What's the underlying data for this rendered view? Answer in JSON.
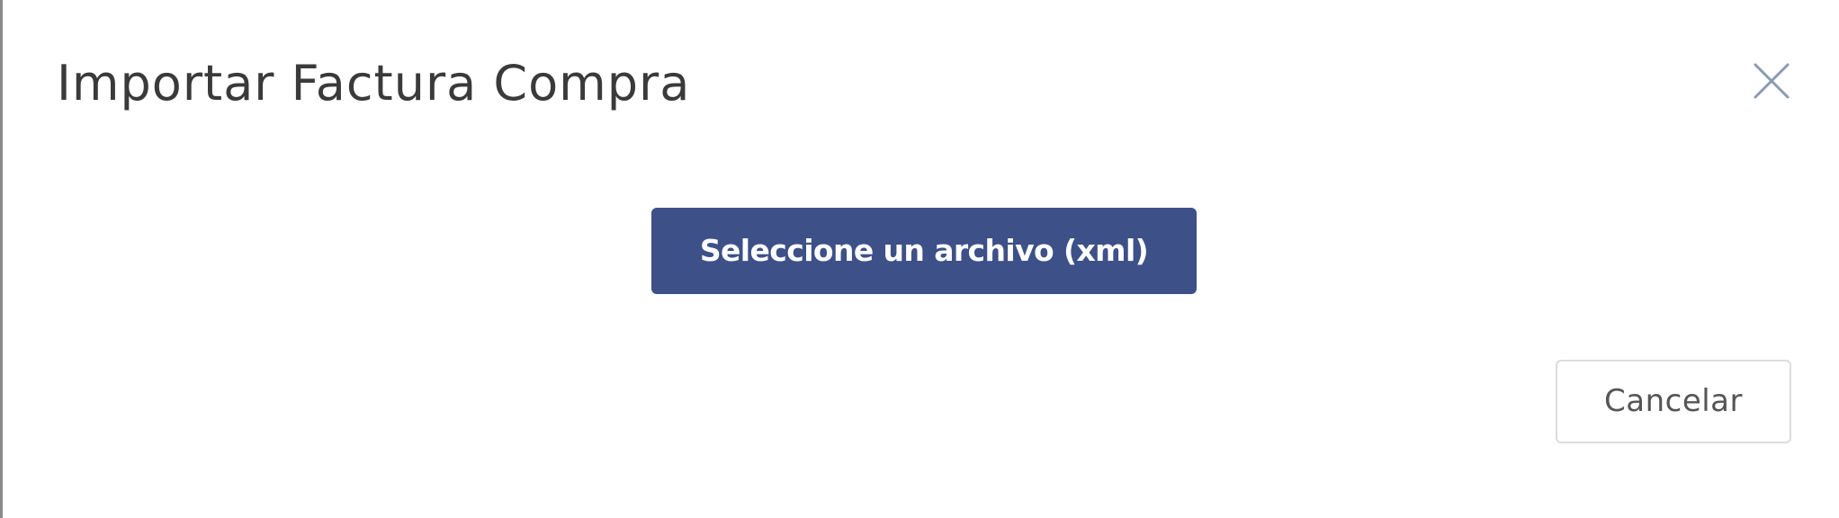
{
  "modal": {
    "title": "Importar Factura Compra",
    "close_icon": "close-icon",
    "file_button_label": "Seleccione un archivo (xml)",
    "cancel_label": "Cancelar"
  },
  "colors": {
    "primary": "#3d5088",
    "title_text": "#3a3a3a",
    "close_icon": "#8a9bb0",
    "cancel_border": "#dcdcdc",
    "cancel_text": "#555555"
  }
}
